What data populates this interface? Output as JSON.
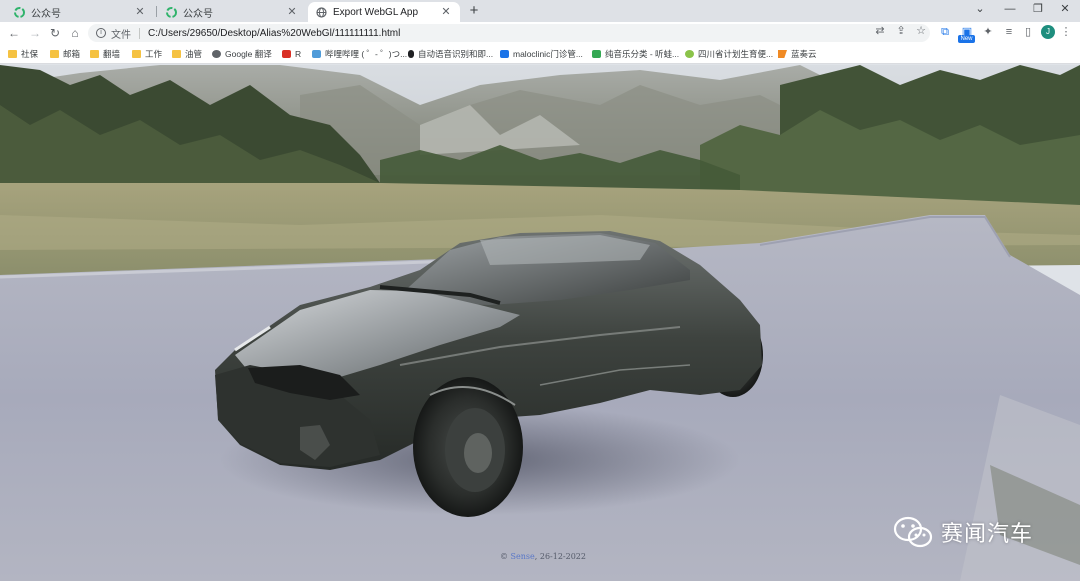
{
  "window": {
    "tabs": [
      {
        "title": "公众号",
        "active": false
      },
      {
        "title": "公众号",
        "active": false
      },
      {
        "title": "Export WebGL App",
        "active": true
      }
    ],
    "controls": {
      "minimize": "—",
      "maximize": "❐",
      "close": "✕",
      "collapse": "⌄"
    }
  },
  "toolbar": {
    "scheme_label": "文件",
    "url": "C:/Users/29650/Desktop/Alias%20WebGl/111111111.html",
    "new_badge": "New",
    "avatar_initial": "J"
  },
  "bookmarks": [
    {
      "label": "社保",
      "icon": "folder"
    },
    {
      "label": "邮箱",
      "icon": "folder"
    },
    {
      "label": "翻墙",
      "icon": "folder"
    },
    {
      "label": "工作",
      "icon": "folder"
    },
    {
      "label": "油管",
      "icon": "folder"
    },
    {
      "label": "Google 翻译",
      "icon": "globe"
    },
    {
      "label": "R",
      "icon": "red"
    },
    {
      "label": "哔哩哔哩 ( ゜- ゜)つ...",
      "icon": "tv"
    },
    {
      "label": "自动语音识别和即...",
      "icon": "mic"
    },
    {
      "label": "maloclinic门诊管...",
      "icon": "blue"
    },
    {
      "label": "纯音乐分类 - 听蛙...",
      "icon": "green"
    },
    {
      "label": "四川省计划生育便...",
      "icon": "lime"
    },
    {
      "label": "蓝奏云",
      "icon": "flag"
    }
  ],
  "scene": {
    "footer_prefix": "©",
    "footer_link": "Sense",
    "footer_date": "26-12-2022",
    "watermark_text": "赛闻汽车"
  },
  "colors": {
    "tabstrip": "#dee1e6",
    "road": "#a4a8b8",
    "car_body": "#3b3f3a",
    "accent": "#1a73e8"
  }
}
